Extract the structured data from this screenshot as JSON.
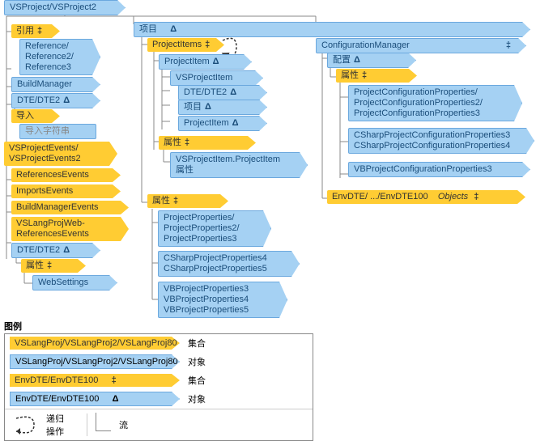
{
  "root": "VSProject/VSProject2",
  "col1": {
    "refs_header": "引用",
    "refs": "Reference/\nReference2/\nReference3",
    "build_manager": "BuildManager",
    "dte1": "DTE/DTE2",
    "import_header": "导入",
    "import_str": "导入字符串",
    "events_header": "VSProjectEvents/\nVSProjectEvents2",
    "refs_events": "ReferencesEvents",
    "imports_events": "ImportsEvents",
    "bm_events": "BuildManagerEvents",
    "vslang_events": "VSLangProjWeb-\nReferencesEvents",
    "dte2": "DTE/DTE2",
    "attr_label": "属性",
    "websettings": "WebSettings"
  },
  "col2": {
    "project_header": "项目",
    "project_items": "ProjectItems",
    "project_item": "ProjectItem",
    "vsproject_item": "VSProjectItem",
    "dte": "DTE/DTE2",
    "project_child": "项目",
    "projectitem2": "ProjectItem",
    "attr_label": "属性",
    "vspi_projectitem": "VSProjectItem.ProjectItem\n属性",
    "attr_label2": "属性",
    "proj_props": "ProjectProperties/\nProjectProperties2/\nProjectProperties3",
    "csharp_props": "CSharpProjectProperties4\nCSharpProjectProperties5",
    "vb_props": "VBProjectProperties3\nVBProjectProperties4\nVBProjectProperties5"
  },
  "col3": {
    "config_mgr": "ConfigurationManager",
    "config_label": "配置",
    "attr_label": "属性",
    "proj_config_props": "ProjectConfigurationProperties/\nProjectConfigurationProperties2/\nProjectConfigurationProperties3",
    "csharp_config": "CSharpProjectConfigurationProperties3\nCSharpProjectConfigurationProperties4",
    "vb_config": "VBProjectConfigurationProperties3",
    "envdte": "EnvDTE/ .../EnvDTE100",
    "objects": "Objects"
  },
  "legend": {
    "title": "图例",
    "row1": {
      "lib": "VSLangProj/VSLangProj2/VSLangProj80",
      "type": "集合"
    },
    "row2": {
      "lib": "VSLangProj/VSLangProj2/VSLangProj80",
      "type": "对象"
    },
    "row3": {
      "lib": "EnvDTE/EnvDTE100",
      "type": "集合"
    },
    "row4": {
      "lib": "EnvDTE/EnvDTE100",
      "type": "对象"
    },
    "recurse": "递归\n操作",
    "stream": "流"
  },
  "symbols": {
    "coll": "‡",
    "obj": "Δ"
  }
}
